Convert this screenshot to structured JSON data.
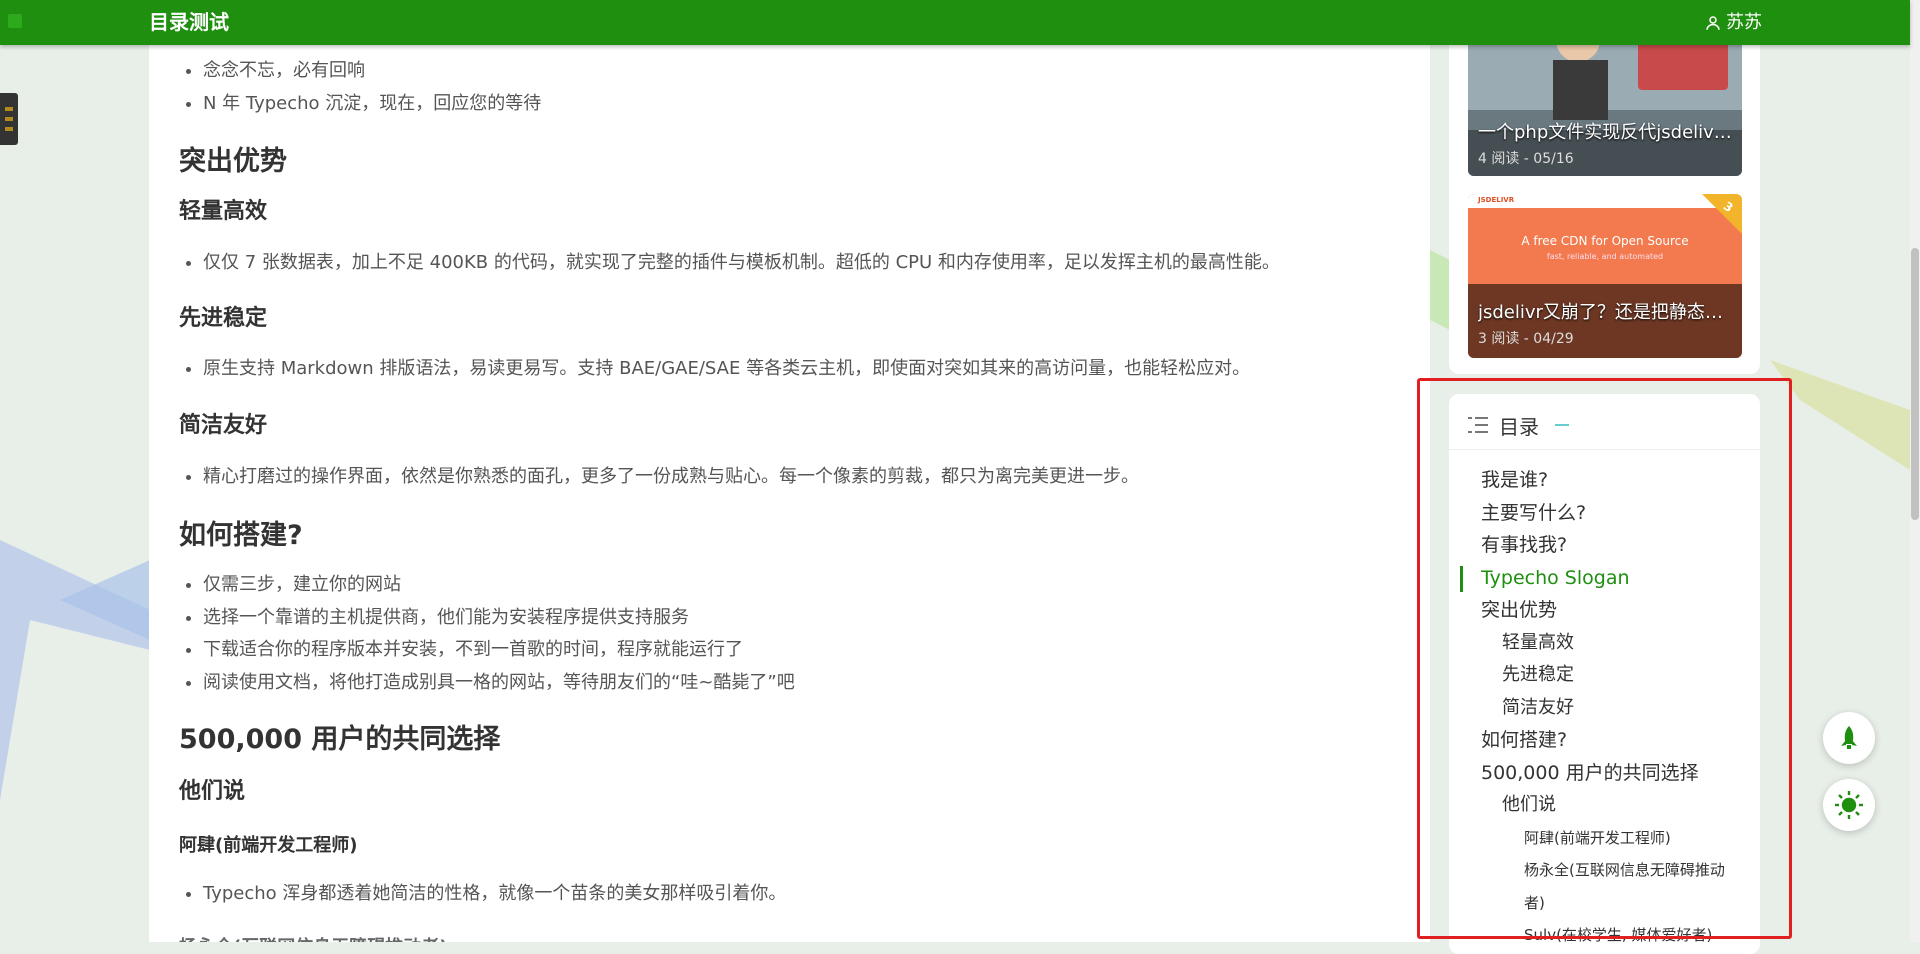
{
  "topbar": {
    "site_title": "目录测试",
    "user_name": "苏苏"
  },
  "article": {
    "intro_items": [
      "念念不忘，必有回响",
      "N 年 Typecho 沉淀，现在，回应您的等待"
    ],
    "h_advantages": "突出优势",
    "h_light": "轻量高效",
    "light_item": "仅仅 7 张数据表，加上不足 400KB 的代码，就实现了完整的插件与模板机制。超低的 CPU 和内存使用率，足以发挥主机的最高性能。",
    "h_stable": "先进稳定",
    "stable_item": "原生支持 Markdown 排版语法，易读更易写。支持 BAE/GAE/SAE 等各类云主机，即使面对突如其来的高访问量，也能轻松应对。",
    "h_simple": "简洁友好",
    "simple_item": "精心打磨过的操作界面，依然是你熟悉的面孔，更多了一份成熟与贴心。每一个像素的剪裁，都只为离完美更进一步。",
    "h_build": "如何搭建?",
    "build_items": [
      "仅需三步，建立你的网站",
      "选择一个靠谱的主机提供商，他们能为安装程序提供支持服务",
      "下载适合你的程序版本并安装，不到一首歌的时间，程序就能运行了",
      "阅读使用文档，将他打造成别具一格的网站，等待朋友们的“哇~酷毙了”吧"
    ],
    "h_users": "500,000 用户的共同选择",
    "h_they": "他们说",
    "h_asi": "阿肆(前端开发工程师)",
    "asi_item": "Typecho 浑身都透着她简洁的性格，就像一个苗条的美女那样吸引着你。",
    "cutoff_heading": "杨永全(互联网信息无障碍推动者)"
  },
  "sidebar": {
    "posts": [
      {
        "title": "一个php文件实现反代jsdelivr...",
        "meta": "4 阅读 - 05/16"
      },
      {
        "title": "jsdelivr又崩了？还是把静态资...",
        "meta": "3 阅读 - 04/29",
        "rank": "3",
        "banner": "A free CDN for Open Source",
        "banner_sub": "fast, reliable, and automated",
        "brand": "JSDELIVR"
      }
    ]
  },
  "toc": {
    "title": "目录",
    "items": [
      {
        "label": "我是谁?",
        "level": 1,
        "active": false
      },
      {
        "label": "主要写什么?",
        "level": 1,
        "active": false
      },
      {
        "label": "有事找我?",
        "level": 1,
        "active": false
      },
      {
        "label": "Typecho Slogan",
        "level": 1,
        "active": true
      },
      {
        "label": "突出优势",
        "level": 1,
        "active": false
      },
      {
        "label": "轻量高效",
        "level": 2,
        "active": false
      },
      {
        "label": "先进稳定",
        "level": 2,
        "active": false
      },
      {
        "label": "简洁友好",
        "level": 2,
        "active": false
      },
      {
        "label": "如何搭建?",
        "level": 1,
        "active": false
      },
      {
        "label": "500,000 用户的共同选择",
        "level": 1,
        "active": false
      },
      {
        "label": "他们说",
        "level": 2,
        "active": false
      },
      {
        "label": "阿肆(前端开发工程师)",
        "level": 3,
        "active": false
      },
      {
        "label": "杨永全(互联网信息无障碍推动",
        "level": 3,
        "active": false
      },
      {
        "label": "者)",
        "level": 3,
        "active": false
      },
      {
        "label": "Sulv(在校学生, 媒体爱好者)",
        "level": 3,
        "active": false
      }
    ]
  },
  "colors": {
    "brand_green": "#1e8f0e",
    "highlight_red": "#e02020"
  },
  "icons": {
    "user": "user-icon",
    "toc": "list-icon",
    "rocket": "rocket-icon",
    "theme": "sun-icon"
  }
}
